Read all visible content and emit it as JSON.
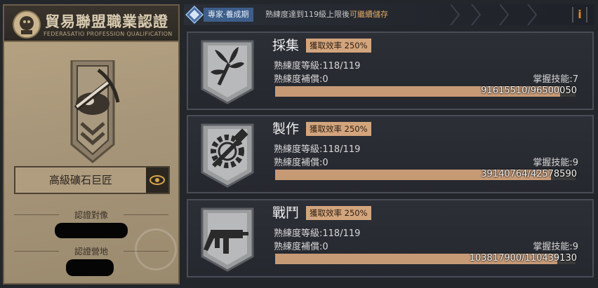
{
  "certificate": {
    "title": "貿易聯盟職業認證",
    "subtitle": "FEDERASATIO PROFESSION QUALIFICATION",
    "rank": "高級礦石巨匠",
    "target_label": "認證對像",
    "base_label": "認證營地"
  },
  "topbar": {
    "tag": "專家·養成期",
    "message_prefix": "熟練度達到119級上限後",
    "message_highlight": "可繼續儲存",
    "info_icon": "i"
  },
  "skills": [
    {
      "name": "採集",
      "efficiency": "獲取效率 250%",
      "level_text": "熟練度等級:118/119",
      "compensation_text": "熟練度補償:0",
      "mastery_text": "掌握技能:7",
      "progress_text": "91615510/96500050",
      "progress_fraction": 0.949,
      "icon": "plant-icon"
    },
    {
      "name": "製作",
      "efficiency": "獲取效率 250%",
      "level_text": "熟練度等級:118/119",
      "compensation_text": "熟練度補償:0",
      "mastery_text": "掌握技能:9",
      "progress_text": "39140764/42578590",
      "progress_fraction": 0.919,
      "icon": "gear-hammer-icon"
    },
    {
      "name": "戰鬥",
      "efficiency": "獲取效率 250%",
      "level_text": "熟練度等級:118/119",
      "compensation_text": "熟練度補償:0",
      "mastery_text": "掌握技能:9",
      "progress_text": "103817900/110439130",
      "progress_fraction": 0.94,
      "icon": "gun-icon"
    }
  ],
  "colors": {
    "accent": "#e48a2a",
    "badge": "#d3a57d",
    "progress_fill": "#c79a76",
    "tag": "#3d5e8a"
  }
}
